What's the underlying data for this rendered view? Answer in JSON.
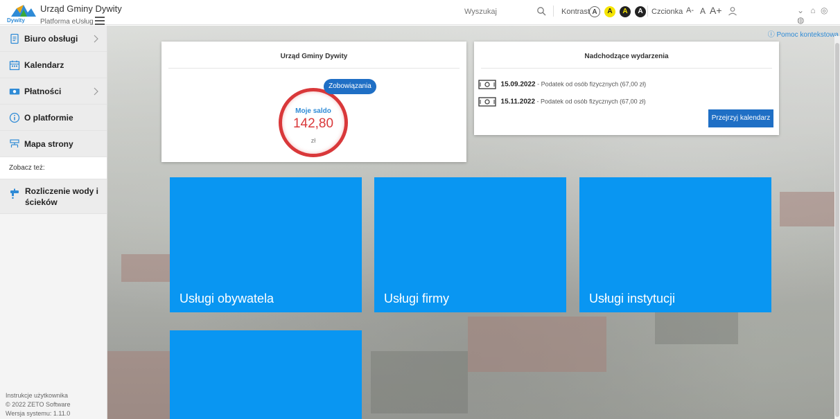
{
  "header": {
    "title": "Urząd Gminy Dywity",
    "logo_text": "Dywity",
    "subtitle": "Platforma eUsług",
    "search_placeholder": "Wyszukaj",
    "contrast_label": "Kontrast",
    "contrast_options": [
      "A",
      "A",
      "A",
      "A"
    ],
    "font_label": "Czcionka",
    "font_options": [
      "A-",
      "A",
      "A+"
    ]
  },
  "help_link": "Pomoc kontekstowa",
  "sidebar": {
    "items": [
      {
        "label": "Biuro obsługi",
        "icon": "document-icon",
        "has_submenu": true
      },
      {
        "label": "Kalendarz",
        "icon": "calendar-icon",
        "has_submenu": false
      },
      {
        "label": "Płatności",
        "icon": "money-icon",
        "has_submenu": true
      },
      {
        "label": "O platformie",
        "icon": "info-icon",
        "has_submenu": false
      },
      {
        "label": "Mapa strony",
        "icon": "sitemap-icon",
        "has_submenu": false
      }
    ],
    "see_also_label": "Zobacz też:",
    "see_also_items": [
      {
        "label": "Rozliczenie wody i ścieków",
        "icon": "water-tap-icon"
      }
    ],
    "footer": [
      "Instrukcje użytkownika",
      "© 2022 ZETO Software",
      "Wersja systemu: 1.11.0"
    ]
  },
  "balance_card": {
    "title": "Urząd Gminy Dywity",
    "obligations_button": "Zobowiązania",
    "saldo_label": "Moje saldo",
    "saldo_value": "142,80",
    "saldo_unit": "zł"
  },
  "events_card": {
    "title": "Nadchodzące wydarzenia",
    "events": [
      {
        "date": "15.09.2022",
        "text": " - Podatek od osób fizycznych (67,00 zł)"
      },
      {
        "date": "15.11.2022",
        "text": " - Podatek od osób fizycznych (67,00 zł)"
      }
    ],
    "calendar_button": "Przejrzyj kalendarz"
  },
  "tiles": [
    {
      "label": "Usługi obywatela"
    },
    {
      "label": "Usługi firmy"
    },
    {
      "label": "Usługi instytucji"
    },
    {
      "label": ""
    }
  ],
  "colors": {
    "accent": "#1f6fc5",
    "tile": "#0996f2",
    "saldo": "#d9383a",
    "help": "#2f8bd6"
  }
}
